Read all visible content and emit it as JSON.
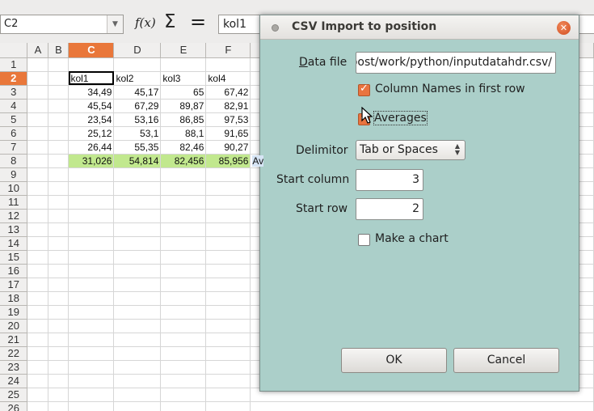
{
  "formula_bar": {
    "name_box": "C2",
    "fx_icon": "f(x)",
    "sum_icon": "Σ",
    "equals_icon": "=",
    "content": "kol1"
  },
  "sheet": {
    "columns": [
      "A",
      "B",
      "C",
      "D",
      "E",
      "F"
    ],
    "active_column": "C",
    "active_row": 2,
    "rows": [
      {
        "n": "1",
        "c": "",
        "d": "",
        "e": "",
        "f": ""
      },
      {
        "n": "2",
        "c": "kol1",
        "d": "kol2",
        "e": "kol3",
        "f": "kol4"
      },
      {
        "n": "3",
        "c": "34,49",
        "d": "45,17",
        "e": "65",
        "f": "67,42"
      },
      {
        "n": "4",
        "c": "45,54",
        "d": "67,29",
        "e": "89,87",
        "f": "82,91"
      },
      {
        "n": "5",
        "c": "23,54",
        "d": "53,16",
        "e": "86,85",
        "f": "97,53"
      },
      {
        "n": "6",
        "c": "25,12",
        "d": "53,1",
        "e": "88,1",
        "f": "91,65"
      },
      {
        "n": "7",
        "c": "26,44",
        "d": "55,35",
        "e": "82,46",
        "f": "90,27"
      },
      {
        "n": "8",
        "c": "31,026",
        "d": "54,814",
        "e": "82,456",
        "f": "85,956",
        "g": "Av"
      },
      {
        "n": "9"
      },
      {
        "n": "10"
      },
      {
        "n": "11"
      },
      {
        "n": "12"
      },
      {
        "n": "13"
      },
      {
        "n": "14"
      },
      {
        "n": "15"
      },
      {
        "n": "16"
      },
      {
        "n": "17"
      },
      {
        "n": "18"
      },
      {
        "n": "19"
      },
      {
        "n": "20"
      },
      {
        "n": "21"
      },
      {
        "n": "22"
      },
      {
        "n": "23"
      },
      {
        "n": "24"
      },
      {
        "n": "25"
      },
      {
        "n": "26"
      }
    ],
    "colors": {
      "active_header": "#e9773a",
      "averages_row": "#c1e88e"
    }
  },
  "dialog": {
    "title": "CSV Import to position",
    "data_file_label": "Data file",
    "data_file_value": "/home/user/Dropbost/work/python/inputdatahdr.csv",
    "column_names_label": "Column Names in first row",
    "column_names_checked": true,
    "averages_label": "Averages",
    "averages_checked": true,
    "delimiter_label": "Delimitor",
    "delimiter_value": "Tab or Spaces",
    "start_column_label": "Start column",
    "start_column_value": "3",
    "start_row_label": "Start row",
    "start_row_value": "2",
    "make_chart_label": "Make a chart",
    "make_chart_checked": false,
    "ok_label": "OK",
    "cancel_label": "Cancel",
    "colors": {
      "background": "#abcfc9",
      "checkbox_on": "#e9743f"
    }
  }
}
